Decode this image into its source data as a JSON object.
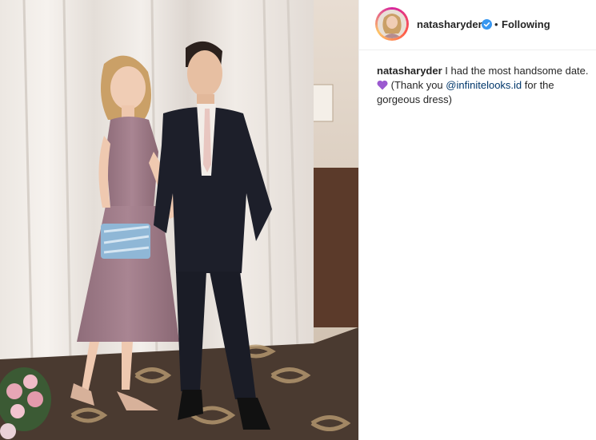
{
  "post": {
    "username": "natasharyder",
    "verified_icon": "verified-badge-icon",
    "separator": "•",
    "follow_status": "Following"
  },
  "caption": {
    "username": "natasharyder",
    "text_1": "I had the most handsome date.",
    "emoji": "purple-heart-icon",
    "text_2": "(Thank you",
    "mention": "@infinitelooks.id",
    "text_3": "for the gorgeous dress)"
  },
  "colors": {
    "verified": "#3897f0",
    "heart": "#9b59d0",
    "mention": "#00376b",
    "text": "#262626"
  }
}
